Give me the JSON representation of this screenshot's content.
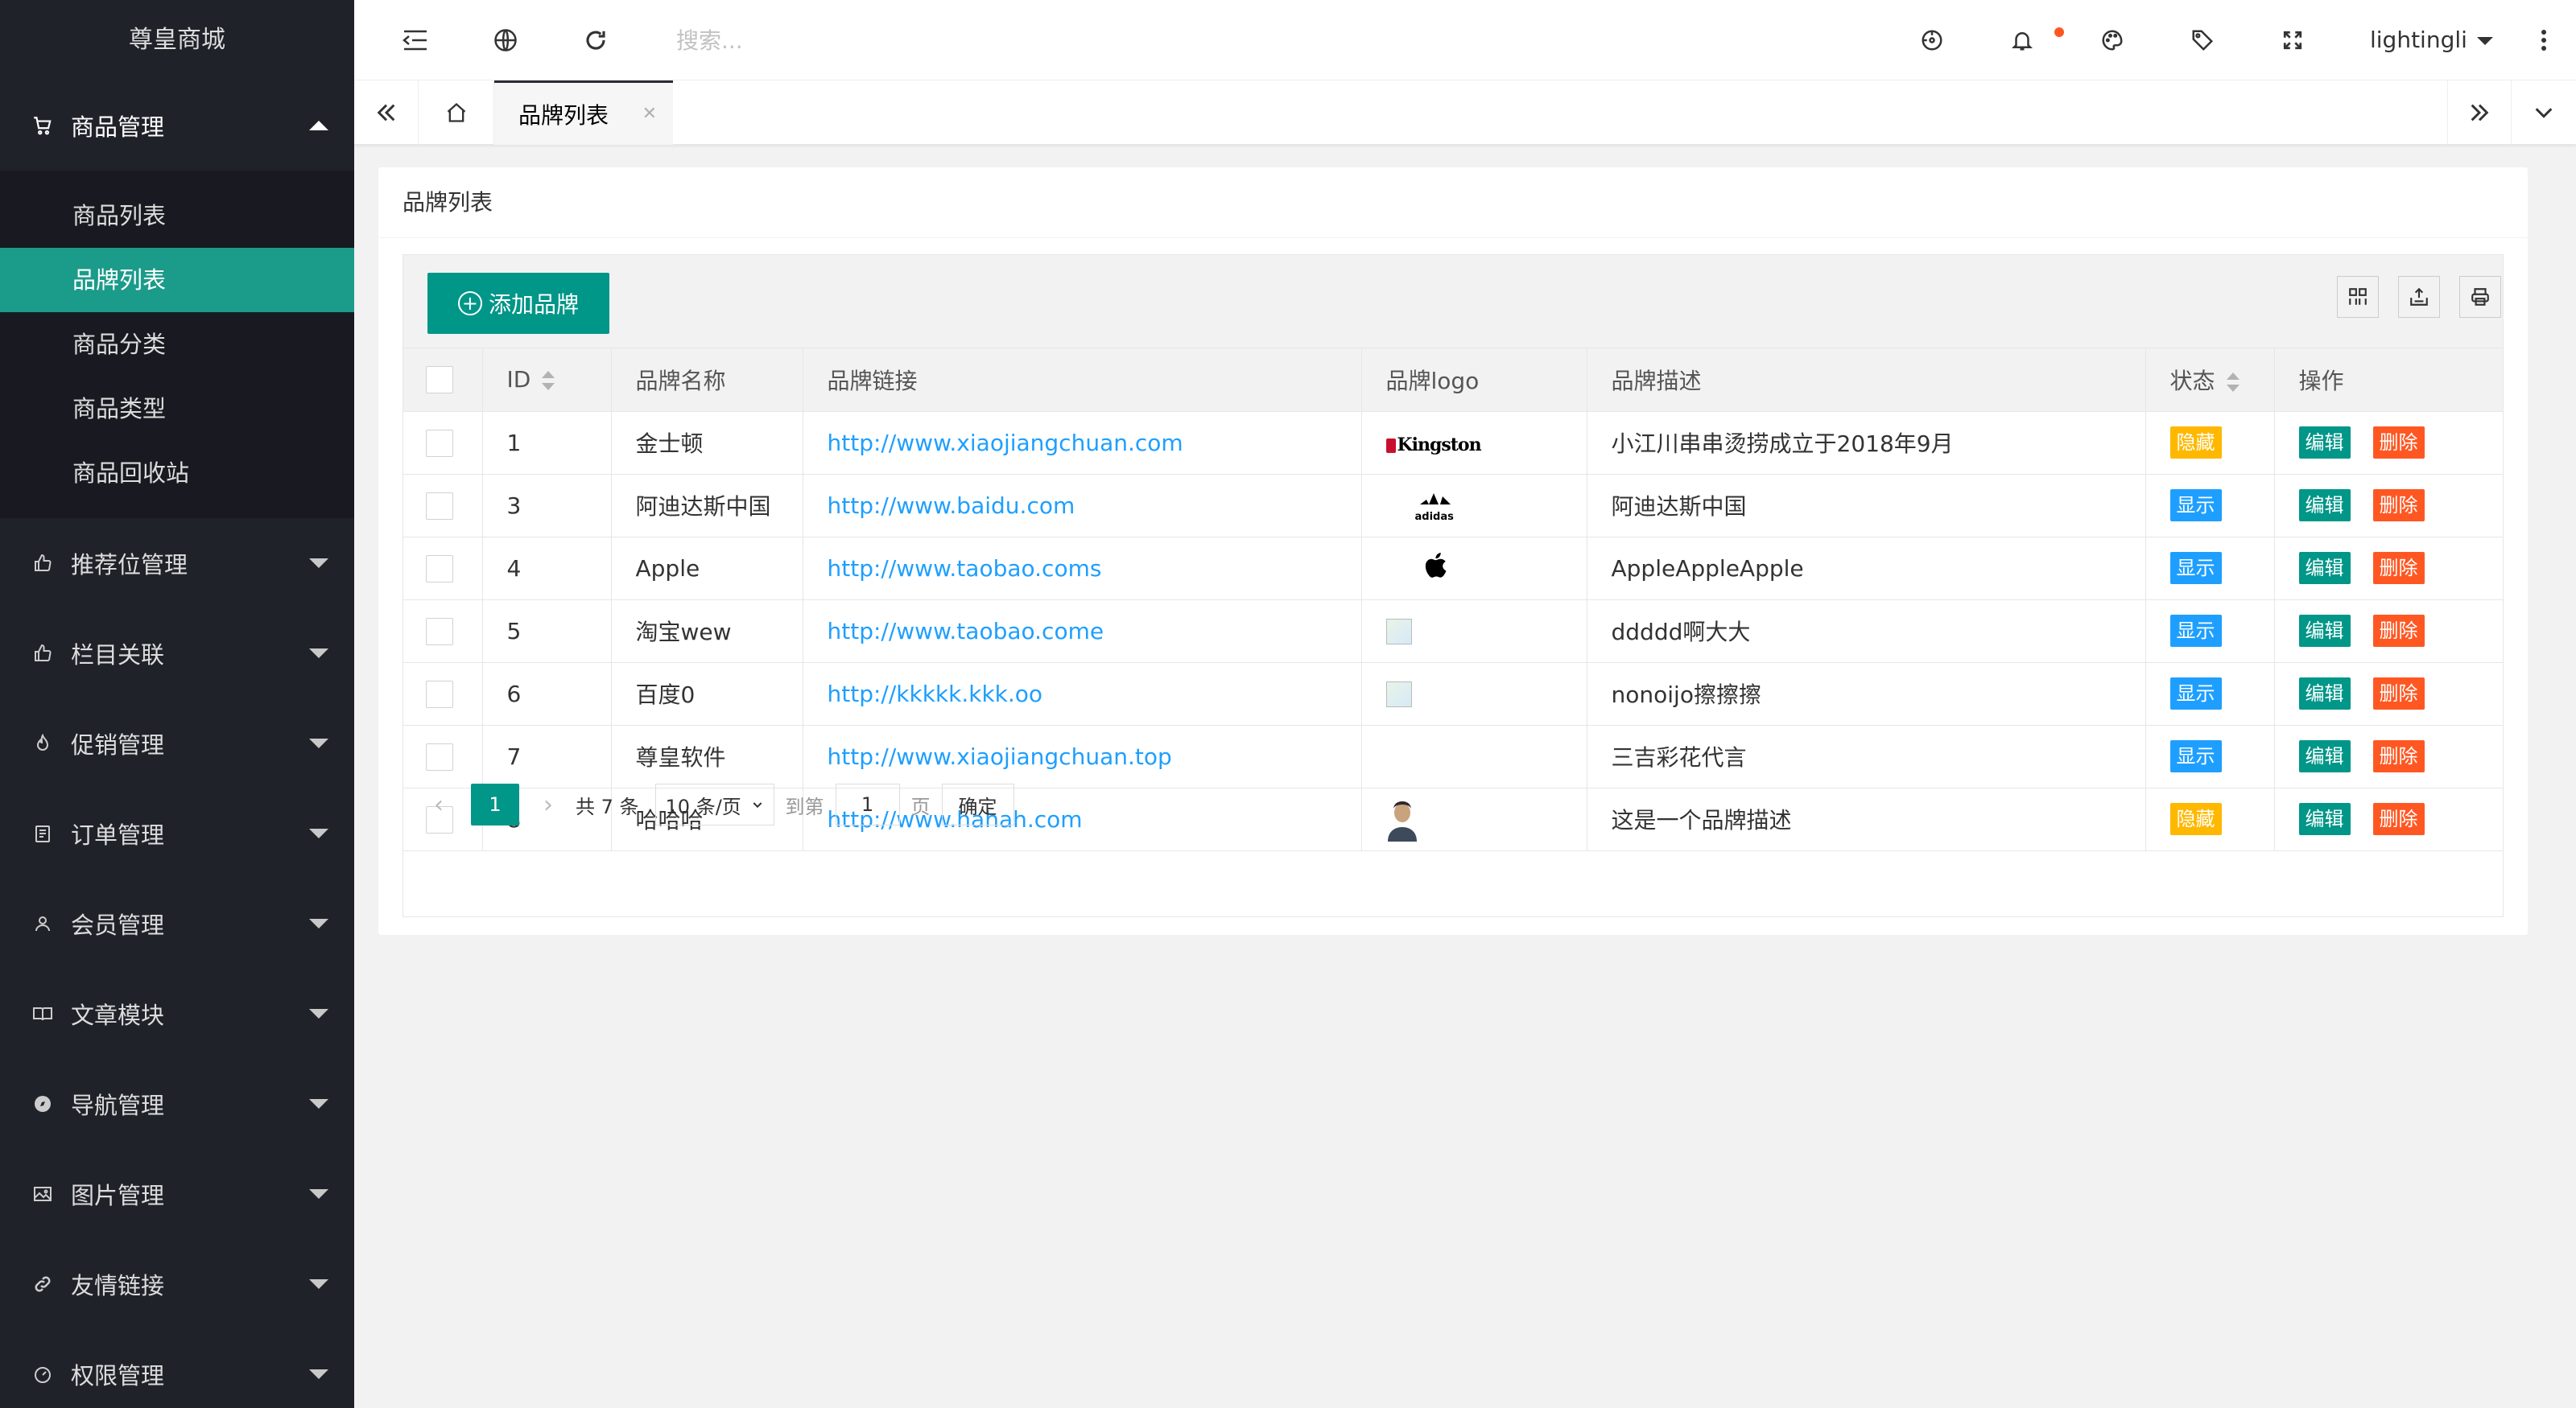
{
  "app": {
    "title": "尊皇商城"
  },
  "sidebar": {
    "groups": [
      {
        "label": "商品管理",
        "icon": "cart-icon",
        "open": true,
        "items": [
          {
            "label": "商品列表",
            "active": false
          },
          {
            "label": "品牌列表",
            "active": true
          },
          {
            "label": "商品分类",
            "active": false
          },
          {
            "label": "商品类型",
            "active": false
          },
          {
            "label": "商品回收站",
            "active": false
          }
        ]
      },
      {
        "label": "推荐位管理",
        "icon": "thumbs-up-icon",
        "open": false
      },
      {
        "label": "栏目关联",
        "icon": "thumbs-up-icon",
        "open": false
      },
      {
        "label": "促销管理",
        "icon": "fire-icon",
        "open": false
      },
      {
        "label": "订单管理",
        "icon": "clipboard-icon",
        "open": false
      },
      {
        "label": "会员管理",
        "icon": "user-icon",
        "open": false
      },
      {
        "label": "文章模块",
        "icon": "book-icon",
        "open": false
      },
      {
        "label": "导航管理",
        "icon": "compass-icon",
        "open": false
      },
      {
        "label": "图片管理",
        "icon": "picture-icon",
        "open": false
      },
      {
        "label": "友情链接",
        "icon": "link-icon",
        "open": false
      },
      {
        "label": "权限管理",
        "icon": "dashboard-icon",
        "open": false
      }
    ]
  },
  "header": {
    "search_placeholder": "搜索...",
    "user": "lightingli",
    "icons": [
      "menu-fold-icon",
      "globe-icon",
      "refresh-icon",
      "screenshot-icon",
      "bell-icon",
      "palette-icon",
      "tag-icon",
      "fullscreen-icon",
      "more-icon"
    ]
  },
  "tabs": {
    "active_tab": "品牌列表"
  },
  "page": {
    "title": "品牌列表",
    "add_button": "添加品牌",
    "columns": [
      "ID",
      "品牌名称",
      "品牌链接",
      "品牌logo",
      "品牌描述",
      "状态",
      "操作"
    ],
    "rows": [
      {
        "id": "1",
        "name": "金士顿",
        "link": "http://www.xiaojiangchuan.com",
        "logo": "kingston",
        "logo_text": "Kingston",
        "desc": "小江川串串烫捞成立于2018年9月",
        "status": "隐藏"
      },
      {
        "id": "3",
        "name": "阿迪达斯中国",
        "link": "http://www.baidu.com",
        "logo": "adidas",
        "logo_text": "adidas",
        "desc": "阿迪达斯中国",
        "status": "显示"
      },
      {
        "id": "4",
        "name": "Apple",
        "link": "http://www.taobao.coms",
        "logo": "apple",
        "logo_text": "",
        "desc": "AppleAppleApple",
        "status": "显示"
      },
      {
        "id": "5",
        "name": "淘宝wew",
        "link": "http://www.taobao.come",
        "logo": "broken",
        "logo_text": "",
        "desc": "ddddd啊大大",
        "status": "显示"
      },
      {
        "id": "6",
        "name": "百度0",
        "link": "http://kkkkk.kkk.oo",
        "logo": "broken",
        "logo_text": "",
        "desc": "nonoijo擦擦擦",
        "status": "显示"
      },
      {
        "id": "7",
        "name": "尊皇软件",
        "link": "http://www.xiaojiangchuan.top",
        "logo": "none",
        "logo_text": "",
        "desc": "三吉彩花代言",
        "status": "显示"
      },
      {
        "id": "8",
        "name": "哈哈哈",
        "link": "http://www.hahah.com",
        "logo": "avatar",
        "logo_text": "",
        "desc": "这是一个品牌描述",
        "status": "隐藏"
      }
    ],
    "actions": {
      "edit": "编辑",
      "delete": "删除"
    }
  },
  "pagination": {
    "current": "1",
    "total_text": "共 7 条",
    "page_size": "10 条/页",
    "goto_label": "到第",
    "goto_value": "1",
    "page_unit": "页",
    "confirm": "确定"
  },
  "colors": {
    "primary": "#009688",
    "sidebar_bg": "#20222a",
    "hidden_badge": "#ffb800",
    "show_badge": "#1e9fff",
    "delete": "#ff5722"
  }
}
